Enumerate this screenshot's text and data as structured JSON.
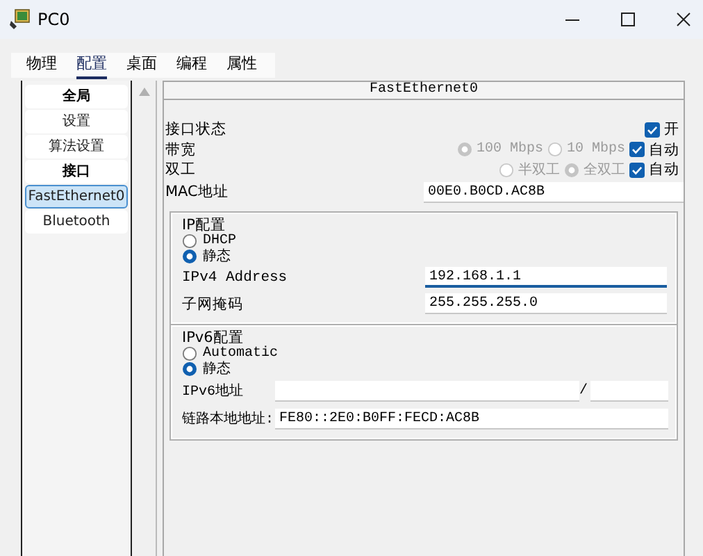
{
  "window": {
    "title": "PC0"
  },
  "tabs": [
    {
      "label": "物理",
      "selected": false
    },
    {
      "label": "配置",
      "selected": true
    },
    {
      "label": "桌面",
      "selected": false
    },
    {
      "label": "编程",
      "selected": false
    },
    {
      "label": "属性",
      "selected": false
    }
  ],
  "sidebar": {
    "items": [
      {
        "label": "全局",
        "kind": "header",
        "selected": false
      },
      {
        "label": "设置",
        "kind": "item",
        "selected": false
      },
      {
        "label": "算法设置",
        "kind": "item",
        "selected": false
      },
      {
        "label": "接口",
        "kind": "header",
        "selected": false
      },
      {
        "label": "FastEthernet0",
        "kind": "item",
        "selected": true
      },
      {
        "label": "Bluetooth",
        "kind": "item",
        "selected": false
      }
    ]
  },
  "panel": {
    "title": "FastEthernet0",
    "port_status": {
      "label": "接口状态",
      "checkbox": {
        "label": "开",
        "checked": true
      }
    },
    "bandwidth": {
      "label": "带宽",
      "options": [
        {
          "label": "100 Mbps",
          "selected": true
        },
        {
          "label": "10 Mbps",
          "selected": false
        }
      ],
      "auto": {
        "label": "自动",
        "checked": true
      }
    },
    "duplex": {
      "label": "双工",
      "options": [
        {
          "label": "半双工",
          "selected": false
        },
        {
          "label": "全双工",
          "selected": true
        }
      ],
      "auto": {
        "label": "自动",
        "checked": true
      }
    },
    "mac": {
      "label": "MAC地址",
      "value": "00E0.B0CD.AC8B"
    },
    "ip_config": {
      "title": "IP配置",
      "modes": [
        {
          "label": "DHCP",
          "selected": false
        },
        {
          "label": "静态",
          "selected": true
        }
      ],
      "fields": [
        {
          "label": "IPv4 Address",
          "value": "192.168.1.1",
          "focused": true
        },
        {
          "label": "子网掩码",
          "value": "255.255.255.0",
          "focused": false
        }
      ]
    },
    "ipv6_config": {
      "title": "IPv6配置",
      "modes": [
        {
          "label": "Automatic",
          "selected": false
        },
        {
          "label": "静态",
          "selected": true
        }
      ],
      "address": {
        "label": "IPv6地址",
        "separator": "/"
      },
      "link_local": {
        "label": "链路本地地址:",
        "value": "FE80::2E0:B0FF:FECD:AC8B"
      }
    }
  }
}
